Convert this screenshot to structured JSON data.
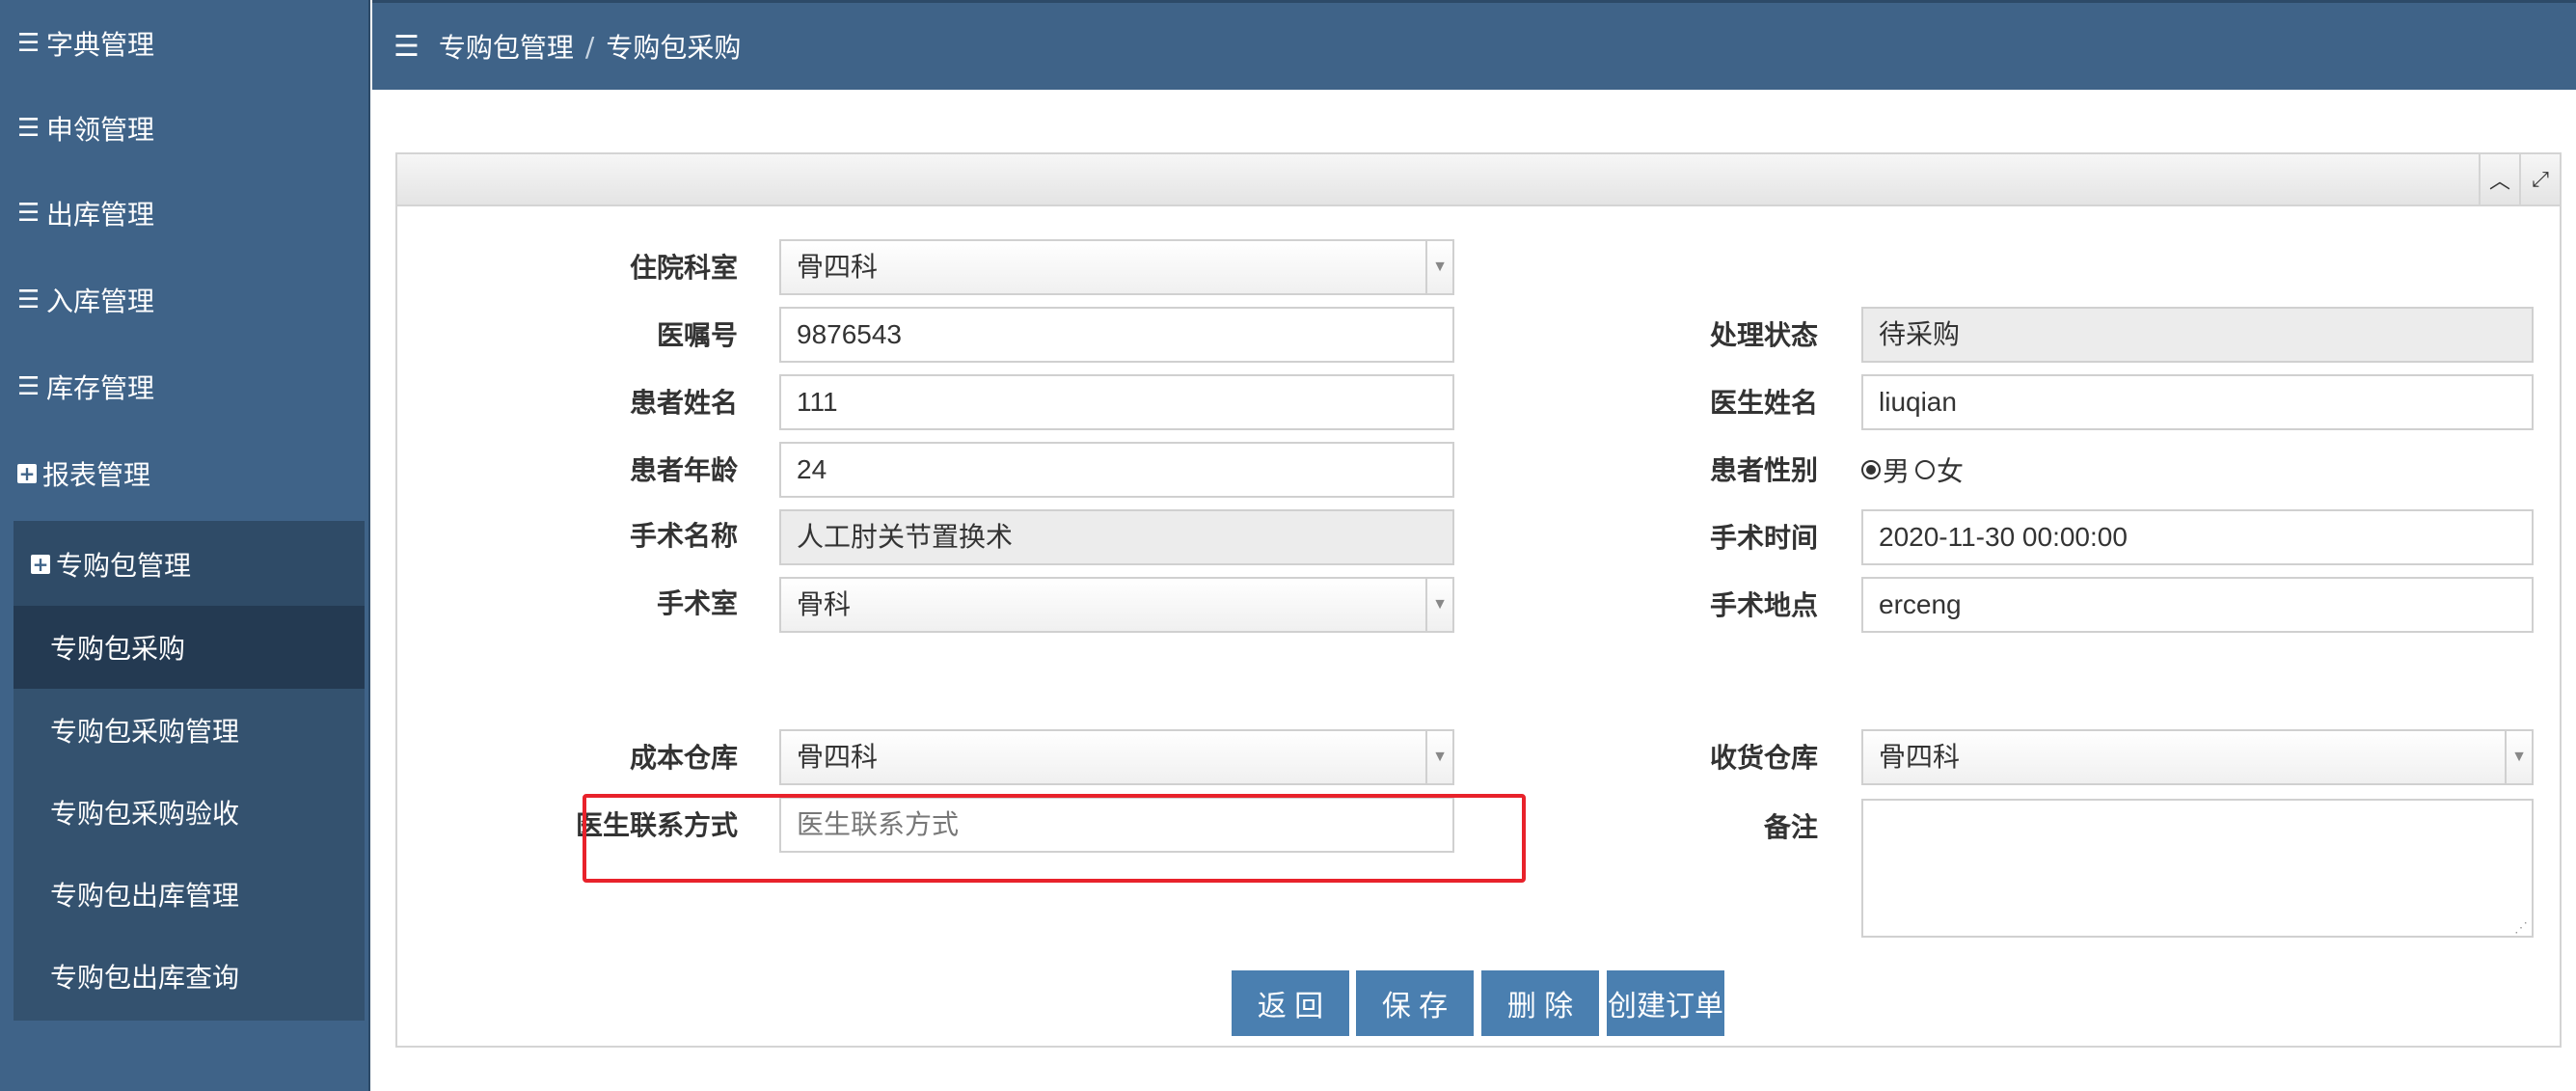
{
  "sidebar": {
    "items": [
      {
        "label": "字典管理",
        "icon": "list-icon"
      },
      {
        "label": "申领管理",
        "icon": "list-icon"
      },
      {
        "label": "出库管理",
        "icon": "list-icon"
      },
      {
        "label": "入库管理",
        "icon": "list-icon"
      },
      {
        "label": "库存管理",
        "icon": "list-icon"
      },
      {
        "label": "报表管理",
        "icon": "plus-square-icon"
      },
      {
        "label": "专购包管理",
        "icon": "plus-square-icon"
      }
    ],
    "submenu": [
      {
        "label": "专购包采购",
        "active": true
      },
      {
        "label": "专购包采购管理"
      },
      {
        "label": "专购包采购验收"
      },
      {
        "label": "专购包出库管理"
      },
      {
        "label": "专购包出库查询"
      }
    ]
  },
  "breadcrumb": {
    "parent": "专购包管理",
    "separator": "/",
    "current": "专购包采购"
  },
  "form": {
    "dept": {
      "label": "住院科室",
      "value": "骨四科"
    },
    "record_no": {
      "label": "医嘱号",
      "value": "9876543"
    },
    "status": {
      "label": "处理状态",
      "value": "待采购"
    },
    "patient_name": {
      "label": "患者姓名",
      "value": "111"
    },
    "doctor_name": {
      "label": "医生姓名",
      "value": "liuqian"
    },
    "patient_age": {
      "label": "患者年龄",
      "value": "24"
    },
    "patient_gender": {
      "label": "患者性别",
      "options": [
        "男",
        "女"
      ],
      "selected": "男"
    },
    "surgery_name": {
      "label": "手术名称",
      "value": "人工肘关节置换术"
    },
    "surgery_time": {
      "label": "手术时间",
      "value": "2020-11-30 00:00:00"
    },
    "operating_room": {
      "label": "手术室",
      "value": "骨科"
    },
    "surgery_location": {
      "label": "手术地点",
      "value": "erceng"
    },
    "cost_warehouse": {
      "label": "成本仓库",
      "value": "骨四科"
    },
    "receiving_warehouse": {
      "label": "收货仓库",
      "value": "骨四科"
    },
    "doctor_contact": {
      "label": "医生联系方式",
      "placeholder": "医生联系方式"
    },
    "remarks": {
      "label": "备注",
      "value": ""
    }
  },
  "buttons": {
    "back": "返 回",
    "save": "保 存",
    "delete": "删 除",
    "create_order": "创建订单"
  },
  "colors": {
    "sidebar_bg": "#3f6388",
    "button_bg": "#4a7fb0",
    "highlight": "#e8222b"
  }
}
